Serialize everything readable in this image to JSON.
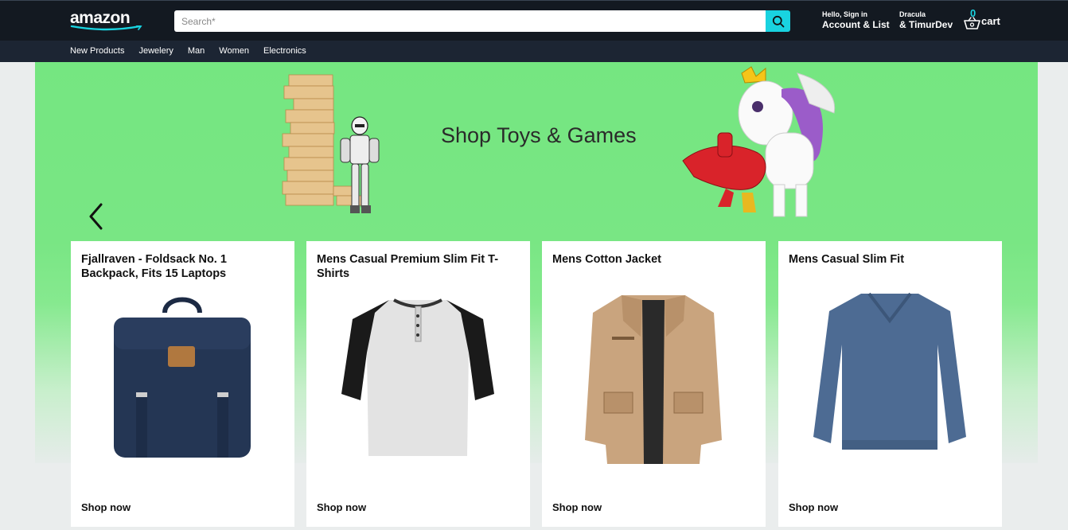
{
  "header": {
    "logo_text": "amazon",
    "search_placeholder": "Search*",
    "greeting_small": "Hello, Sign in",
    "greeting_big": "Account & List",
    "user_small": "Dracula",
    "user_big": "& TimurDev",
    "cart_count": "0",
    "cart_label": "cart",
    "accent_color": "#19d3e0"
  },
  "nav": {
    "items": [
      "New Products",
      "Jewelery",
      "Man",
      "Women",
      "Electronics"
    ]
  },
  "hero": {
    "title": "Shop Toys & Games",
    "prev_icon": "chevron-left-icon",
    "next_icon": "chevron-right-icon"
  },
  "products": [
    {
      "title": "Fjallraven - Foldsack No. 1 Backpack, Fits 15 Laptops",
      "link": "Shop now",
      "icon": "backpack-image"
    },
    {
      "title": "Mens Casual Premium Slim Fit T-Shirts",
      "link": "Shop now",
      "icon": "tshirt-image"
    },
    {
      "title": "Mens Cotton Jacket",
      "link": "Shop now",
      "icon": "jacket-image"
    },
    {
      "title": "Mens Casual Slim Fit",
      "link": "Shop now",
      "icon": "sweater-image"
    }
  ]
}
